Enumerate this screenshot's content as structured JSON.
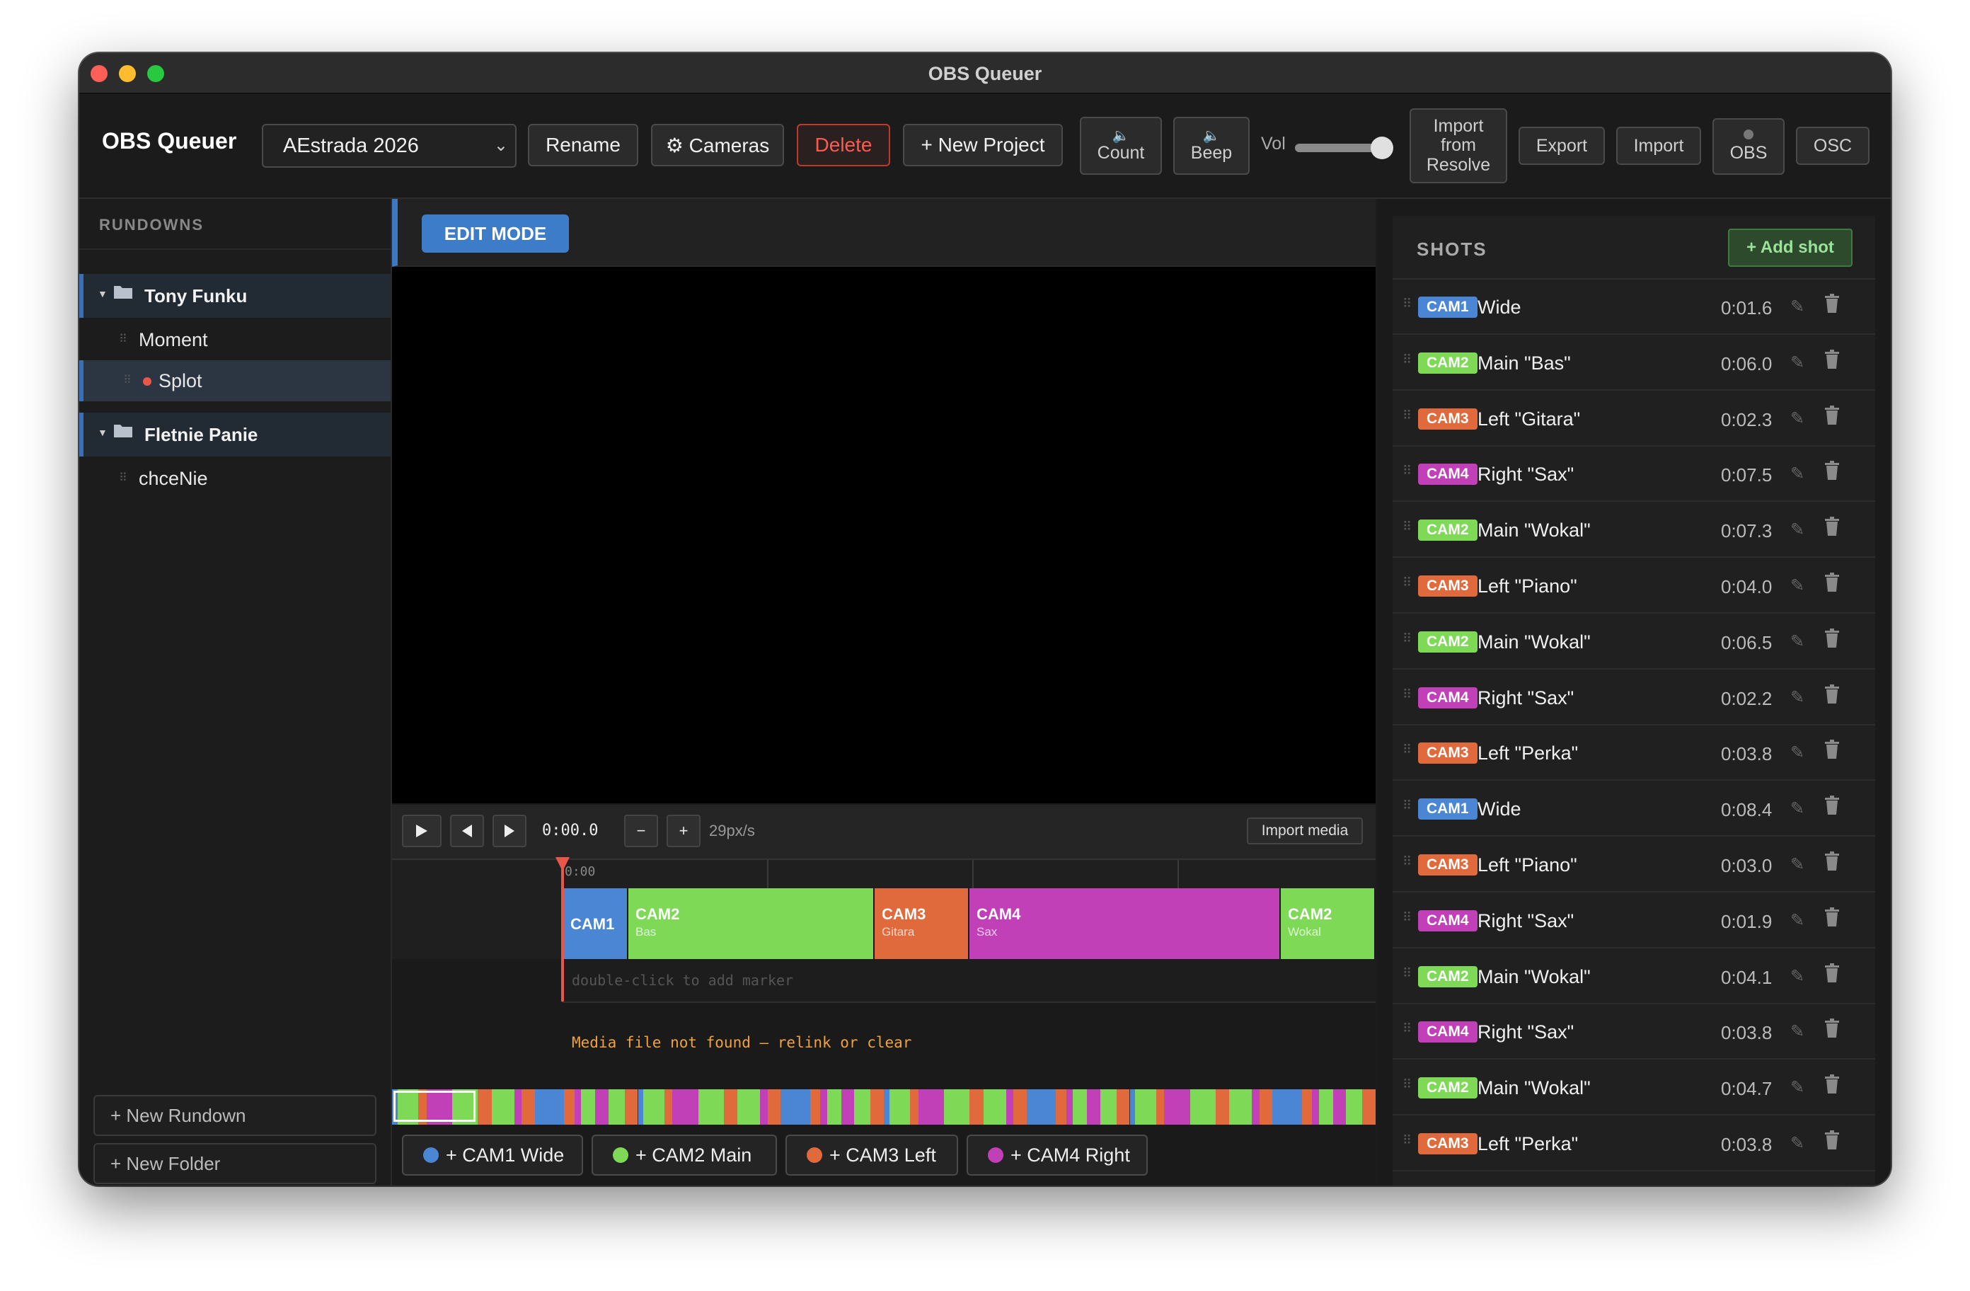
{
  "window": {
    "title": "OBS Queuer"
  },
  "toolbar": {
    "app_name": "OBS Queuer",
    "project": "AEstrada 2026",
    "rename": "Rename",
    "cameras": "⚙ Cameras",
    "delete": "Delete",
    "new_project": "+ New Project",
    "count": "Count",
    "beep": "Beep",
    "vol": "Vol",
    "volume_level": 0.9,
    "import_resolve": [
      "Import",
      "from",
      "Resolve"
    ],
    "export": "Export",
    "import": "Import",
    "obs": "OBS",
    "osc": "OSC"
  },
  "sidebar": {
    "heading": "RUNDOWNS",
    "folders": [
      {
        "name": "Tony Funku",
        "items": [
          "Moment",
          "Splot"
        ]
      },
      {
        "name": "Fletnie Panie",
        "items": [
          "chceNie"
        ]
      }
    ],
    "active_item": "Splot",
    "new_rundown": "+ New Rundown",
    "new_folder": "+ New Folder"
  },
  "editor": {
    "edit_mode": "EDIT MODE",
    "time": "0:00.0",
    "zoom_minus": "−",
    "zoom_plus": "+",
    "zoom": "29px/s",
    "import_media": "Import media",
    "ruler_start": "0:00",
    "marker_hint": "double-click to add marker",
    "media_msg": "Media file not found — relink or clear"
  },
  "timeline_clips": [
    {
      "cam": "CAM1",
      "sub": "",
      "color": "#4a86d4"
    },
    {
      "cam": "CAM2",
      "sub": "Bas",
      "color": "#7ed957"
    },
    {
      "cam": "CAM3",
      "sub": "Gitara",
      "color": "#e06a3b"
    },
    {
      "cam": "CAM4",
      "sub": "Sax",
      "color": "#c13fb7"
    },
    {
      "cam": "CAM2",
      "sub": "Wokal",
      "color": "#7ed957"
    }
  ],
  "cam_buttons": [
    {
      "label": "+ CAM1 Wide",
      "color": "#4a86d4"
    },
    {
      "label": "+ CAM2 Main",
      "color": "#7ed957"
    },
    {
      "label": "+ CAM3 Left",
      "color": "#e06a3b"
    },
    {
      "label": "+ CAM4 Right",
      "color": "#c13fb7"
    }
  ],
  "cam_colors": {
    "CAM1": "#4a86d4",
    "CAM2": "#7ed957",
    "CAM3": "#e06a3b",
    "CAM4": "#c13fb7"
  },
  "shots": {
    "heading": "SHOTS",
    "add_shot": "+ Add shot",
    "rows": [
      {
        "cam": "CAM1",
        "name": "Wide",
        "dur": "0:01.6"
      },
      {
        "cam": "CAM2",
        "name": "Main \"Bas\"",
        "dur": "0:06.0"
      },
      {
        "cam": "CAM3",
        "name": "Left \"Gitara\"",
        "dur": "0:02.3"
      },
      {
        "cam": "CAM4",
        "name": "Right \"Sax\"",
        "dur": "0:07.5"
      },
      {
        "cam": "CAM2",
        "name": "Main \"Wokal\"",
        "dur": "0:07.3"
      },
      {
        "cam": "CAM3",
        "name": "Left \"Piano\"",
        "dur": "0:04.0"
      },
      {
        "cam": "CAM2",
        "name": "Main \"Wokal\"",
        "dur": "0:06.5"
      },
      {
        "cam": "CAM4",
        "name": "Right \"Sax\"",
        "dur": "0:02.2"
      },
      {
        "cam": "CAM3",
        "name": "Left \"Perka\"",
        "dur": "0:03.8"
      },
      {
        "cam": "CAM1",
        "name": "Wide",
        "dur": "0:08.4"
      },
      {
        "cam": "CAM3",
        "name": "Left \"Piano\"",
        "dur": "0:03.0"
      },
      {
        "cam": "CAM4",
        "name": "Right \"Sax\"",
        "dur": "0:01.9"
      },
      {
        "cam": "CAM2",
        "name": "Main \"Wokal\"",
        "dur": "0:04.1"
      },
      {
        "cam": "CAM4",
        "name": "Right \"Sax\"",
        "dur": "0:03.8"
      },
      {
        "cam": "CAM2",
        "name": "Main \"Wokal\"",
        "dur": "0:04.7"
      },
      {
        "cam": "CAM3",
        "name": "Left \"Perka\"",
        "dur": "0:03.8"
      }
    ]
  }
}
